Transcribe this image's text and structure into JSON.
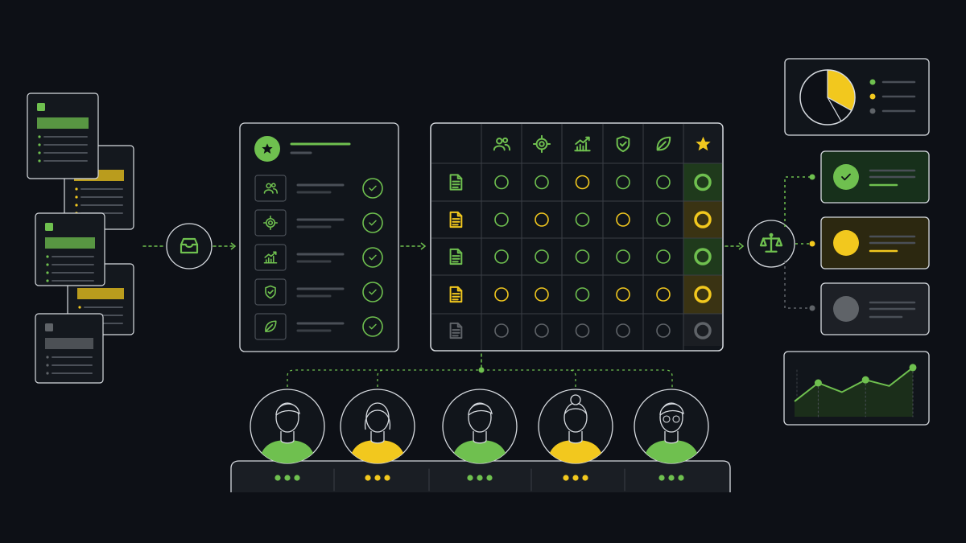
{
  "colors": {
    "background": "#0d1016",
    "panel": "#11151b",
    "stroke": "#d7dbe0",
    "green": "#6fc04f",
    "yellow": "#f2c81e",
    "gray": "#5f6368",
    "muted": "#4a4f57"
  },
  "documents": [
    {
      "status": "green",
      "icon": "document-icon"
    },
    {
      "status": "yellow",
      "icon": "document-icon"
    },
    {
      "status": "green",
      "icon": "document-icon"
    },
    {
      "status": "yellow",
      "icon": "document-icon"
    },
    {
      "status": "gray",
      "icon": "document-icon"
    }
  ],
  "criteria": [
    {
      "name": "team",
      "icon": "people-icon"
    },
    {
      "name": "target",
      "icon": "target-icon"
    },
    {
      "name": "growth",
      "icon": "chart-icon"
    },
    {
      "name": "security",
      "icon": "shield-check-icon"
    },
    {
      "name": "sustainability",
      "icon": "leaf-icon"
    }
  ],
  "checklist_header_icon": "star-icon",
  "matrix": {
    "header_icons": [
      "people-icon",
      "target-icon",
      "chart-icon",
      "shield-check-icon",
      "leaf-icon",
      "star-icon"
    ],
    "rows": [
      {
        "doc_status": "green",
        "cells": [
          "green",
          "green",
          "yellow",
          "green",
          "green"
        ],
        "score": "green"
      },
      {
        "doc_status": "yellow",
        "cells": [
          "green",
          "yellow",
          "green",
          "yellow",
          "green"
        ],
        "score": "yellow"
      },
      {
        "doc_status": "green",
        "cells": [
          "green",
          "green",
          "green",
          "green",
          "green"
        ],
        "score": "green"
      },
      {
        "doc_status": "yellow",
        "cells": [
          "yellow",
          "yellow",
          "green",
          "yellow",
          "yellow"
        ],
        "score": "yellow"
      },
      {
        "doc_status": "gray",
        "cells": [
          "gray",
          "gray",
          "gray",
          "gray",
          "gray"
        ],
        "score": "gray"
      }
    ]
  },
  "reviewers": [
    {
      "color": "green",
      "hair": "short"
    },
    {
      "color": "yellow",
      "hair": "bob"
    },
    {
      "color": "green",
      "hair": "short"
    },
    {
      "color": "yellow",
      "hair": "bun"
    },
    {
      "color": "green",
      "hair": "glasses"
    }
  ],
  "decision_icon": "scales-icon",
  "inbox_icon": "inbox-icon",
  "pie": {
    "segments": [
      {
        "color": "yellow",
        "fraction": 0.33
      },
      {
        "color": "dark",
        "fraction": 0.67
      }
    ]
  },
  "legend": [
    "green",
    "yellow",
    "gray"
  ],
  "outcomes": [
    {
      "status": "green",
      "icon": "check-circle-icon"
    },
    {
      "status": "yellow",
      "icon": "circle-icon"
    },
    {
      "status": "gray",
      "icon": "circle-icon"
    }
  ],
  "trend_chart": {
    "values": [
      1.0,
      2.2,
      1.6,
      2.4,
      2.0,
      3.2
    ]
  }
}
